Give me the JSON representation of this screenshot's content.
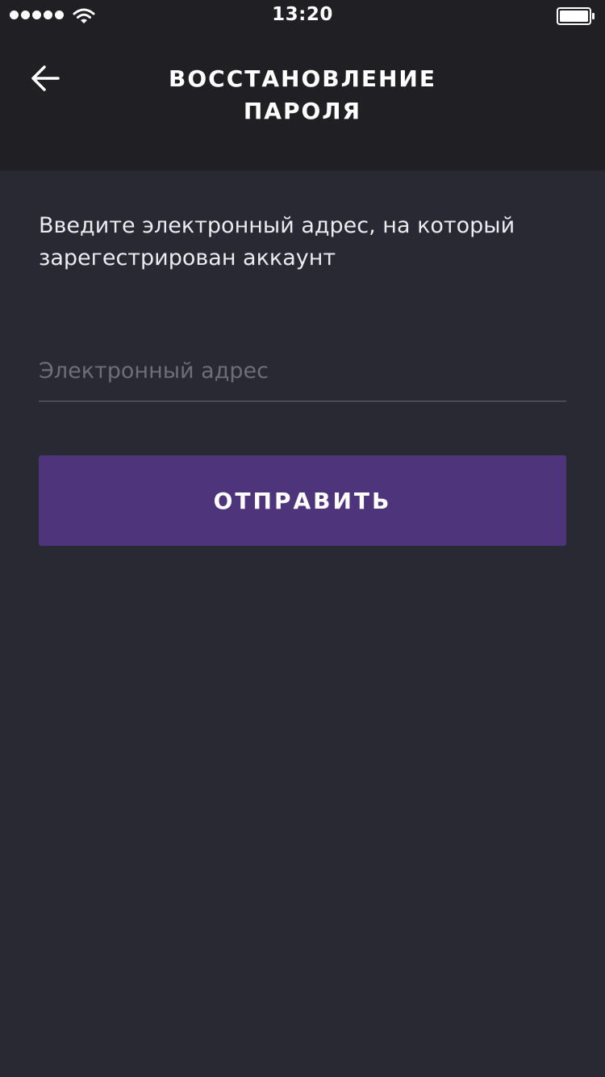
{
  "status_bar": {
    "time": "13:20",
    "signal_icon": "signal-dots-icon",
    "wifi_icon": "wifi-icon",
    "battery_icon": "battery-icon",
    "battery_level": 1.0
  },
  "header": {
    "title": "ВОССТАНОВЛЕНИЕ ПАРОЛЯ",
    "back_icon": "arrow-left-icon",
    "background_color": "#1f1f24"
  },
  "form": {
    "instruction": "Введите электронный адрес, на который зарегестрирован аккаунт",
    "email": {
      "placeholder": "Электронный адрес",
      "value": ""
    },
    "submit_label": "ОТПРАВИТЬ"
  },
  "colors": {
    "background": "#292933",
    "accent": "#4e347a",
    "text": "#ecebf0",
    "placeholder": "#6e6d78"
  }
}
